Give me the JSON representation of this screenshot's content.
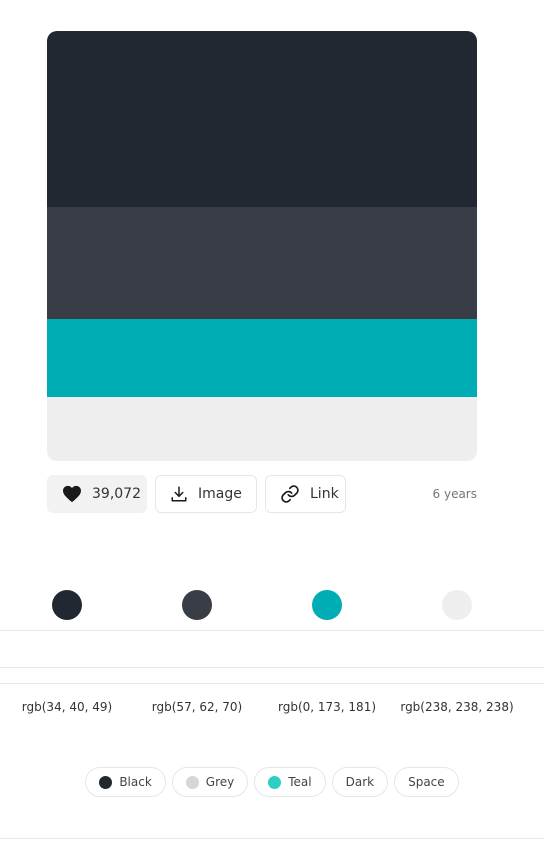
{
  "palette": {
    "colors": [
      {
        "hex": "#222831",
        "rgb": "rgb(34, 40, 49)"
      },
      {
        "hex": "#393e46",
        "rgb": "rgb(57, 62, 70)"
      },
      {
        "hex": "#00adb5",
        "rgb": "rgb(0, 173, 181)"
      },
      {
        "hex": "#eeeeee",
        "rgb": "rgb(238, 238, 238)"
      }
    ]
  },
  "actions": {
    "likes": "39,072",
    "image_label": "Image",
    "link_label": "Link",
    "age": "6 years"
  },
  "tags": [
    {
      "label": "Black",
      "color": "#222831"
    },
    {
      "label": "Grey",
      "color": "#d6d6d6"
    },
    {
      "label": "Teal",
      "color": "#2ecfc2"
    },
    {
      "label": "Dark"
    },
    {
      "label": "Space"
    }
  ]
}
